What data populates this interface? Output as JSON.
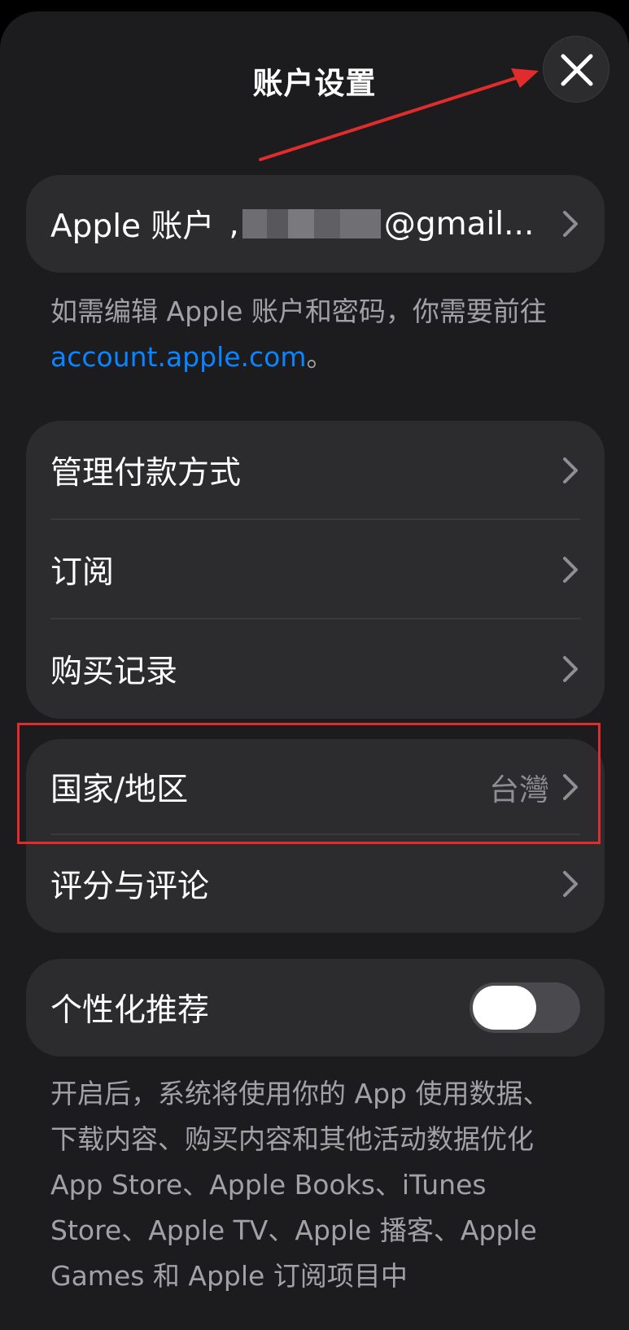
{
  "header": {
    "title": "账户设置",
    "close_icon": "close-icon"
  },
  "account": {
    "label": "Apple 账户",
    "email_prefix": ",",
    "email_suffix": "@gmail..."
  },
  "account_note": {
    "text": "如需编辑 Apple 账户和密码，你需要前往 ",
    "link": "account.apple.com",
    "end": "。"
  },
  "menu": {
    "payment": "管理付款方式",
    "subscriptions": "订阅",
    "purchases": "购买记录",
    "country_region": "国家/地区",
    "country_region_value": "台灣",
    "ratings": "评分与评论",
    "personalized": "个性化推荐",
    "personalized_on": false
  },
  "personalized_note": {
    "text": "开启后，系统将使用你的 App 使用数据、下载内容、购买内容和其他活动数据优化 App Store、Apple Books、iTunes Store、Apple TV、Apple 播客、Apple Games 和 Apple 订阅项目中"
  },
  "colors": {
    "background": "#1c1c1e",
    "card": "#2c2c2e",
    "link": "#0a84ff",
    "annotation": "#e02c2c"
  }
}
